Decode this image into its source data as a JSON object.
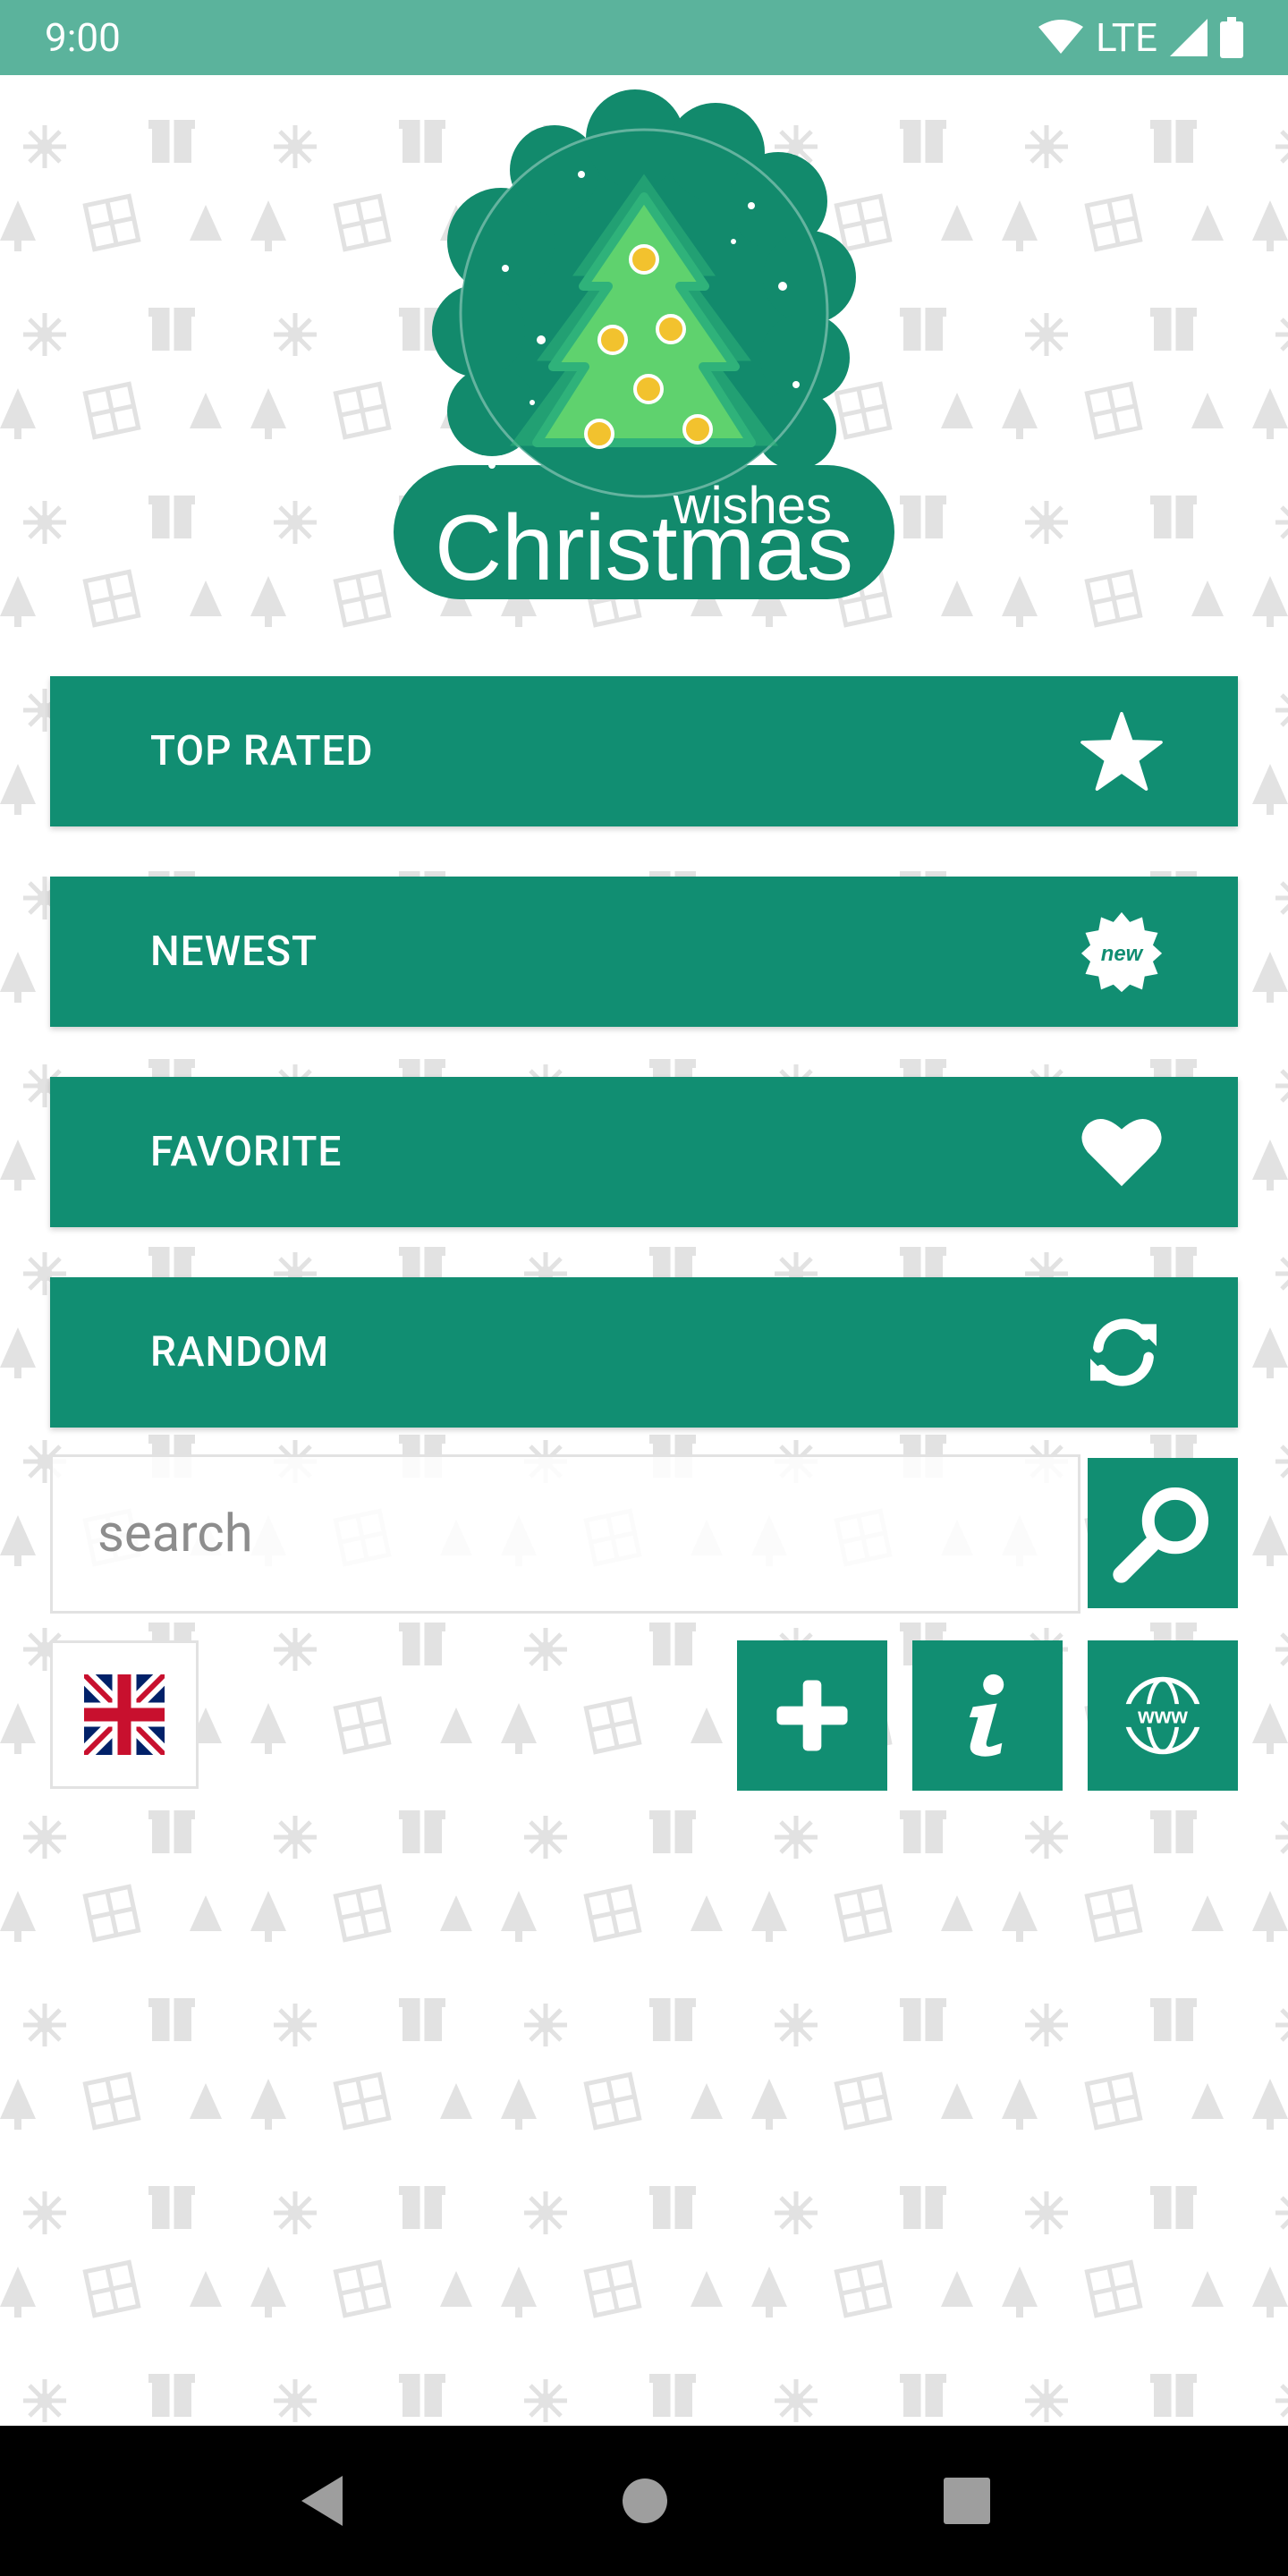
{
  "status_bar": {
    "time": "9:00",
    "network": "LTE"
  },
  "logo": {
    "line1": "wishes",
    "line2": "Christmas"
  },
  "menu": {
    "top_rated": "TOP RATED",
    "newest": "NEWEST",
    "favorite": "FAVORITE",
    "random": "RANDOM",
    "new_badge_text": "new"
  },
  "search": {
    "placeholder": "search"
  },
  "web_badge_text": "www",
  "colors": {
    "primary": "#118e72",
    "status_bar": "#5bb39c",
    "logo_dark": "#128a6c",
    "ornament": "#f2c22e"
  }
}
